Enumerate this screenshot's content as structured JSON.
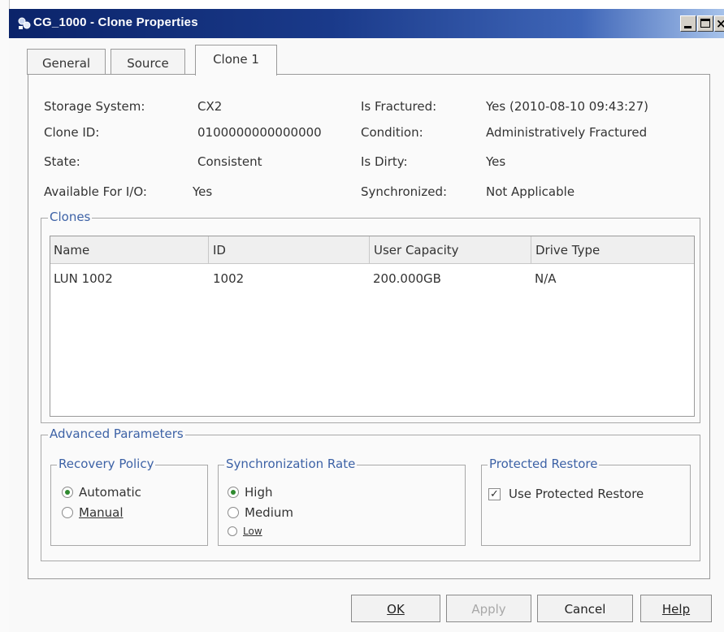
{
  "window": {
    "title": "CG_1000 - Clone Properties"
  },
  "tabs": [
    {
      "label": "General"
    },
    {
      "label": "Source"
    },
    {
      "label": "Clone 1"
    }
  ],
  "properties": {
    "storage_system": {
      "label": "Storage System:",
      "value": "CX2"
    },
    "clone_id": {
      "label": "Clone ID:",
      "value": "0100000000000000"
    },
    "state": {
      "label": "State:",
      "value": "Consistent"
    },
    "available_for_io": {
      "label": "Available For I/O:",
      "value": "Yes"
    },
    "is_fractured": {
      "label": "Is Fractured:",
      "value": "Yes (2010-08-10 09:43:27)"
    },
    "condition": {
      "label": "Condition:",
      "value": "Administratively Fractured"
    },
    "is_dirty": {
      "label": "Is Dirty:",
      "value": "Yes"
    },
    "synchronized": {
      "label": "Synchronized:",
      "value": "Not Applicable"
    }
  },
  "clones_group": {
    "legend": "Clones",
    "columns": [
      "Name",
      "ID",
      "User Capacity",
      "Drive Type"
    ],
    "rows": [
      {
        "name": "LUN 1002",
        "id": "1002",
        "capacity": "200.000GB",
        "drive_type": "N/A"
      }
    ]
  },
  "advanced": {
    "legend": "Advanced Parameters",
    "recovery_policy": {
      "legend": "Recovery Policy",
      "options": [
        {
          "label": "Automatic",
          "selected": true
        },
        {
          "label": "Manual",
          "selected": false
        }
      ]
    },
    "sync_rate": {
      "legend": "Synchronization Rate",
      "options": [
        {
          "label": "High",
          "selected": true
        },
        {
          "label": "Medium",
          "selected": false
        },
        {
          "label": "Low",
          "selected": false
        }
      ]
    },
    "protected_restore": {
      "legend": "Protected Restore",
      "checkbox_label": "Use Protected Restore",
      "checked": true
    }
  },
  "buttons": {
    "ok": "OK",
    "apply": "Apply",
    "cancel": "Cancel",
    "help": "Help"
  },
  "colors": {
    "title_bar": "#0b246a",
    "group_legend": "#3d62a6",
    "radio_selected": "#2f8a2f"
  }
}
